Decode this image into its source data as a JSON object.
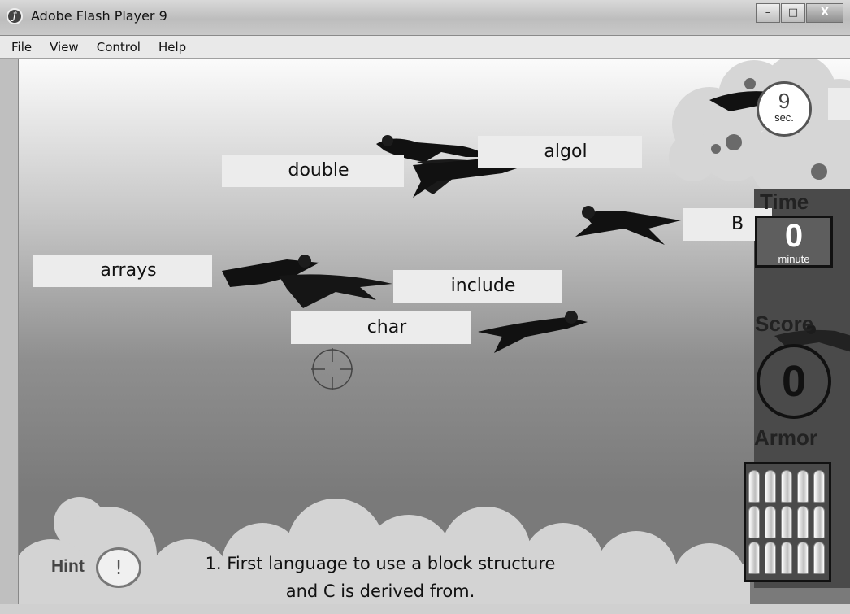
{
  "window": {
    "title": "Adobe Flash Player 9",
    "icon": "flash-icon",
    "controls": {
      "minimize": "–",
      "maximize": "□",
      "close": "X"
    }
  },
  "menu": [
    {
      "label": "File"
    },
    {
      "label": "View"
    },
    {
      "label": "Control"
    },
    {
      "label": "Help"
    }
  ],
  "game": {
    "words": [
      "double",
      "algol",
      "arrays",
      "include",
      "char",
      "B"
    ],
    "stopwatch": {
      "value": "9",
      "unit": "sec."
    },
    "time": {
      "label": "Time",
      "value": "0",
      "unit": "minute"
    },
    "score": {
      "label": "Score",
      "value": "0"
    },
    "armor": {
      "label": "Armor",
      "bullets_remaining": 15
    },
    "hint": {
      "label": "Hint",
      "button": "!"
    },
    "question": {
      "line1": "1. First language to use a block structure",
      "line2": "and C is derived from."
    }
  },
  "colors": {
    "panel": "#4a4a4a",
    "word_box": "#ececec",
    "cloud": "#d6d6d6"
  }
}
